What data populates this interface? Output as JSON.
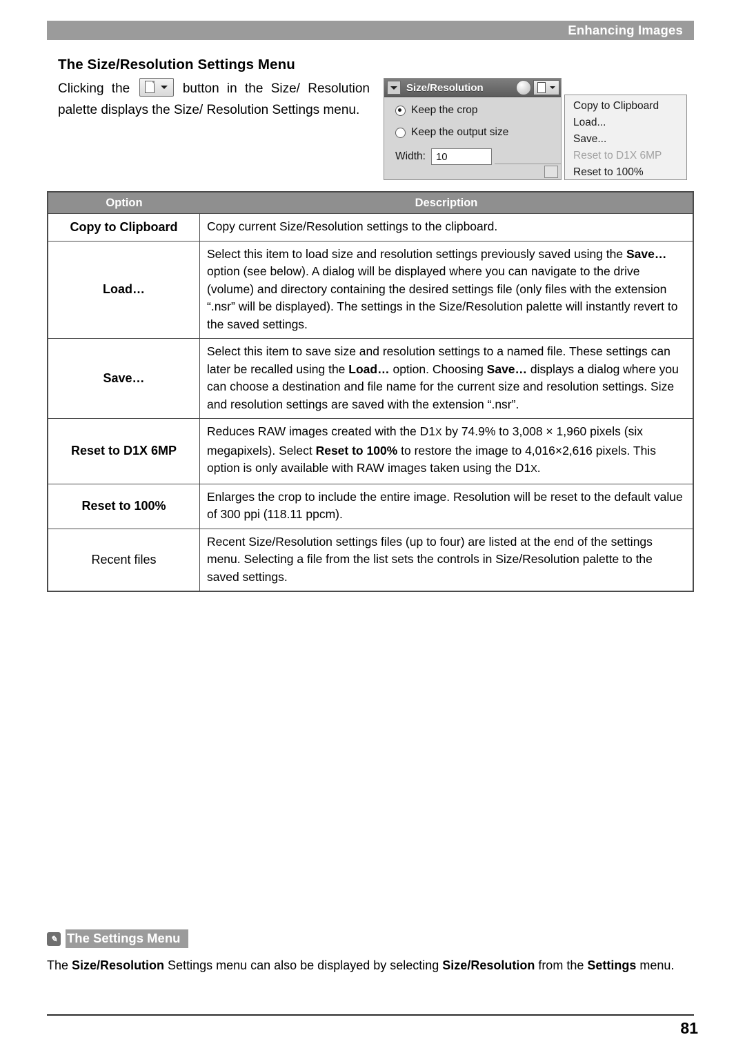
{
  "header": {
    "running_title": "Enhancing Images"
  },
  "section": {
    "heading": "The Size/Resolution Settings Menu",
    "intro_before": "Clicking   the",
    "intro_after": "button   in   the   Size/ Resolution   palette   displays   the   Size/ Resolution Settings menu."
  },
  "screenshot_palette": {
    "window_title": "Size/Resolution",
    "radio_keep_crop": "Keep the crop",
    "radio_keep_output": "Keep the output size",
    "width_label": "Width:",
    "width_value": "10",
    "arrow_icon": "collapse-triangle-icon",
    "circle_icon": "palette-knob-icon",
    "page_icon": "settings-menu-button-icon"
  },
  "screenshot_menu": {
    "items": [
      {
        "label": "Copy to Clipboard",
        "disabled": false
      },
      {
        "label": "Load...",
        "disabled": false
      },
      {
        "label": "Save...",
        "disabled": false
      },
      {
        "label": "Reset to D1X 6MP",
        "disabled": true
      },
      {
        "label": "Reset to 100%",
        "disabled": false
      }
    ]
  },
  "table": {
    "headers": {
      "option": "Option",
      "description": "Description"
    },
    "rows": [
      {
        "option": "Copy to Clipboard",
        "option_bold": true,
        "paragraphs": [
          "Copy current Size/Resolution settings to the clipboard."
        ]
      },
      {
        "option": "Load…",
        "option_bold": true,
        "paragraphs": [
          "Select this item to load size and resolution settings previously saved using the <b>Save…</b> option (see below). A dialog will be displayed where you can navigate to the drive (volume) and directory containing the desired settings file (only files with the extension “.nsr” will be displayed). The settings in the Size/Resolution palette will instantly revert to the saved settings."
        ]
      },
      {
        "option": "Save…",
        "option_bold": true,
        "paragraphs": [
          "Select this item to save size and resolution settings to a named file. These settings can later be recalled using the <b>Load…</b> option. Choosing <b>Save…</b> displays a dialog where you can choose a destination and file name for the current size and resolution settings. Size and resolution settings are saved with the extension “.nsr”."
        ]
      },
      {
        "option": "Reset to D1X 6MP",
        "option_bold": true,
        "paragraphs": [
          "Reduces RAW images created with the D1<span class=\"sc\">X</span> by 74.9% to 3,008 × 1,960 pixels (six megapixels). Select <b>Reset to 100%</b> to restore the image to 4,016×2,616 pixels. This option is only available with RAW images taken using the D1<span class=\"sc\">X</span>."
        ]
      },
      {
        "option": "Reset to 100%",
        "option_bold": true,
        "paragraphs": [
          "Enlarges the crop to include the entire image. Resolution will be reset to the default value of 300 ppi (118.11 ppcm)."
        ]
      },
      {
        "option": "Recent files",
        "option_bold": false,
        "paragraphs": [
          "Recent Size/Resolution settings files (up to four) are listed at the end of the settings menu. Selecting a file from the list sets the controls in Size/Resolution palette to the saved settings."
        ]
      }
    ]
  },
  "note": {
    "badge": "✎",
    "title": "The Settings Menu",
    "body": "The <b>Size/Resolution</b> Settings menu can also be displayed by selecting <b>Size/Resolution</b> from the <b>Settings</b> menu."
  },
  "footer": {
    "page_number": "81"
  }
}
